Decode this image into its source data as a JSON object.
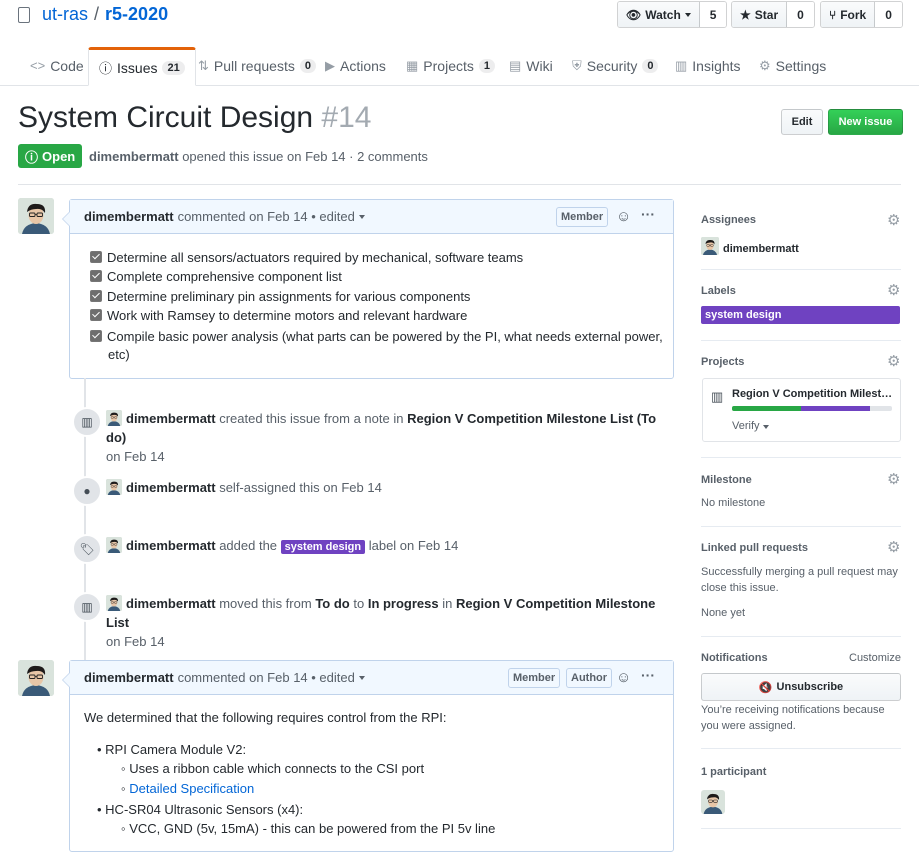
{
  "repo": {
    "owner": "ut-ras",
    "separator": "/",
    "name": "r5-2020"
  },
  "actions": {
    "watch": {
      "label": "Watch",
      "count": "5"
    },
    "star": {
      "label": "Star",
      "count": "0"
    },
    "fork": {
      "label": "Fork",
      "count": "0"
    }
  },
  "tabs": [
    {
      "label": "Code",
      "icon": "code-icon"
    },
    {
      "label": "Issues",
      "count": "21",
      "icon": "issue-opened-icon"
    },
    {
      "label": "Pull requests",
      "count": "0",
      "icon": "git-pull-request-icon"
    },
    {
      "label": "Actions",
      "icon": "play-icon"
    },
    {
      "label": "Projects",
      "count": "1",
      "icon": "project-icon"
    },
    {
      "label": "Wiki",
      "icon": "book-icon"
    },
    {
      "label": "Security",
      "count": "0",
      "icon": "shield-icon"
    },
    {
      "label": "Insights",
      "icon": "graph-icon"
    },
    {
      "label": "Settings",
      "icon": "gear-icon"
    }
  ],
  "issue": {
    "title": "System Circuit Design",
    "number": "#14",
    "edit_label": "Edit",
    "new_label": "New issue",
    "state": "Open",
    "author": "dimembermatt",
    "meta": "opened this issue on Feb 14 · 2 comments"
  },
  "comment1": {
    "author": "dimembermatt",
    "meta": "commented on Feb 14 • edited",
    "role": "Member",
    "tasks": [
      "Determine all sensors/actuators required by mechanical, software teams",
      "Complete comprehensive component list",
      "Determine preliminary pin assignments for various components",
      "Work with Ramsey to determine motors and relevant hardware",
      "Compile basic power analysis (what parts can be powered by the PI, what needs external power,",
      "etc)"
    ]
  },
  "events": [
    {
      "actor": "dimembermatt",
      "text1": "created this issue from a note in",
      "strong1": "Region V Competition Milestone List",
      "paren": "(To do)",
      "line2": "on Feb 14"
    },
    {
      "actor": "dimembermatt",
      "text1": "self-assigned this on Feb 14"
    },
    {
      "actor": "dimembermatt",
      "text1": "added the",
      "label": "system design",
      "text2": "label on Feb 14"
    },
    {
      "actor": "dimembermatt",
      "text1": "moved this from",
      "from": "To do",
      "to_word": "to",
      "to": "In progress",
      "in_word": "in",
      "project": "Region V Competition Milestone List",
      "line2": "on Feb 14"
    }
  ],
  "comment2": {
    "author": "dimembermatt",
    "meta": "commented on Feb 14 • edited",
    "role1": "Member",
    "role2": "Author",
    "intro": "We determined that the following requires control from the RPI:",
    "item1": "RPI Camera Module V2:",
    "item1_sub1": "Uses a ribbon cable which connects to the CSI port",
    "item1_sub2": "Detailed Specification",
    "item2": "HC-SR04 Ultrasonic Sensors (x4):",
    "item2_sub1": "VCC, GND (5v, 15mA) - this can be powered from the PI 5v line"
  },
  "sidebar": {
    "assignees_title": "Assignees",
    "assignee": "dimembermatt",
    "labels_title": "Labels",
    "label": "system design",
    "projects_title": "Projects",
    "project_name": "Region V Competition Milest…",
    "project_status": "Verify",
    "project_progress": {
      "done": 0.43,
      "in_progress": 0.43
    },
    "milestone_title": "Milestone",
    "milestone_value": "No milestone",
    "linked_title": "Linked pull requests",
    "linked_desc1": "Successfully merging a pull request may",
    "linked_desc2": "close this issue.",
    "linked_value": "None yet",
    "notif_title": "Notifications",
    "notif_customize": "Customize",
    "unsubscribe": "Unsubscribe",
    "notif_desc1": "You’re receiving notifications because",
    "notif_desc2": "you were assigned.",
    "participants_title": "1 participant"
  },
  "colors": {
    "accent_green": "#28a745",
    "label_purple": "#6f42c1",
    "link_blue": "#0366d6",
    "tab_orange": "#e36209"
  }
}
